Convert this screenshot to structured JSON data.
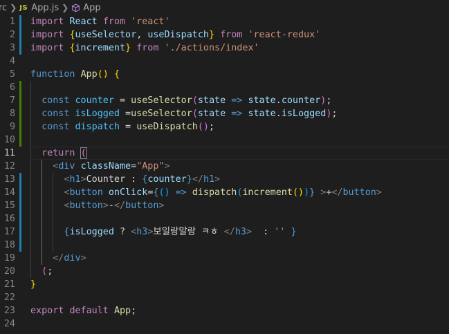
{
  "breadcrumb": {
    "folder": "rc",
    "file_badge": "JS",
    "file": "App.js",
    "symbol": "App",
    "icons": [
      "chevron-right-icon",
      "cube-icon"
    ]
  },
  "theme": {
    "background": "#1e1e1e",
    "keyword": "#c586c0",
    "storage": "#569cd6",
    "string": "#ce9178",
    "variable": "#9cdcfe",
    "function": "#dcdcaa",
    "git_modified": "#1b81a8",
    "git_added": "#487e02"
  },
  "editor": {
    "current_line": 11,
    "lines": [
      {
        "n": "1",
        "tokens": [
          [
            "k",
            "import"
          ],
          [
            "p",
            " "
          ],
          [
            "v",
            "React"
          ],
          [
            "p",
            " "
          ],
          [
            "k",
            "from"
          ],
          [
            "p",
            " "
          ],
          [
            "s",
            "'react'"
          ]
        ]
      },
      {
        "n": "2",
        "tokens": [
          [
            "k",
            "import"
          ],
          [
            "p",
            " "
          ],
          [
            "y",
            "{"
          ],
          [
            "v",
            "useSelector"
          ],
          [
            "p",
            ", "
          ],
          [
            "v",
            "useDispatch"
          ],
          [
            "y",
            "}"
          ],
          [
            "p",
            " "
          ],
          [
            "k",
            "from"
          ],
          [
            "p",
            " "
          ],
          [
            "s",
            "'react-redux'"
          ]
        ]
      },
      {
        "n": "3",
        "tokens": [
          [
            "k",
            "import"
          ],
          [
            "p",
            " "
          ],
          [
            "y",
            "{"
          ],
          [
            "v",
            "increment"
          ],
          [
            "y",
            "}"
          ],
          [
            "p",
            " "
          ],
          [
            "k",
            "from"
          ],
          [
            "p",
            " "
          ],
          [
            "s",
            "'./actions/index'"
          ]
        ]
      },
      {
        "n": "4",
        "tokens": []
      },
      {
        "n": "5",
        "tokens": [
          [
            "b",
            "function"
          ],
          [
            "p",
            " "
          ],
          [
            "f",
            "App"
          ],
          [
            "y",
            "()"
          ],
          [
            "p",
            " "
          ],
          [
            "y",
            "{"
          ]
        ]
      },
      {
        "n": "6",
        "tokens": []
      },
      {
        "n": "7",
        "tokens": [
          [
            "p",
            "  "
          ],
          [
            "b",
            "const"
          ],
          [
            "p",
            " "
          ],
          [
            "c",
            "counter"
          ],
          [
            "p",
            " = "
          ],
          [
            "f",
            "useSelector"
          ],
          [
            "m",
            "("
          ],
          [
            "v",
            "state"
          ],
          [
            "p",
            " "
          ],
          [
            "b",
            "=>"
          ],
          [
            "p",
            " "
          ],
          [
            "v",
            "state"
          ],
          [
            "p",
            "."
          ],
          [
            "v",
            "counter"
          ],
          [
            "m",
            ")"
          ],
          [
            "p",
            ";"
          ]
        ]
      },
      {
        "n": "8",
        "tokens": [
          [
            "p",
            "  "
          ],
          [
            "b",
            "const"
          ],
          [
            "p",
            " "
          ],
          [
            "c",
            "isLogged"
          ],
          [
            "p",
            " ="
          ],
          [
            "f",
            "useSelector"
          ],
          [
            "m",
            "("
          ],
          [
            "v",
            "state"
          ],
          [
            "p",
            " "
          ],
          [
            "b",
            "=>"
          ],
          [
            "p",
            " "
          ],
          [
            "v",
            "state"
          ],
          [
            "p",
            "."
          ],
          [
            "v",
            "isLogged"
          ],
          [
            "m",
            ")"
          ],
          [
            "p",
            ";"
          ]
        ]
      },
      {
        "n": "9",
        "tokens": [
          [
            "p",
            "  "
          ],
          [
            "b",
            "const"
          ],
          [
            "p",
            " "
          ],
          [
            "c",
            "dispatch"
          ],
          [
            "p",
            " = "
          ],
          [
            "f",
            "useDispatch"
          ],
          [
            "m",
            "()"
          ],
          [
            "p",
            ";"
          ]
        ]
      },
      {
        "n": "10",
        "tokens": []
      },
      {
        "n": "11",
        "tokens": [
          [
            "p",
            "  "
          ],
          [
            "k",
            "return"
          ],
          [
            "p",
            " "
          ],
          [
            "m bm",
            "("
          ]
        ]
      },
      {
        "n": "12",
        "tokens": [
          [
            "p",
            "    "
          ],
          [
            "t",
            "<"
          ],
          [
            "b",
            "div"
          ],
          [
            "p",
            " "
          ],
          [
            "v",
            "className"
          ],
          [
            "p",
            "="
          ],
          [
            "s",
            "\"App\""
          ],
          [
            "t",
            ">"
          ]
        ]
      },
      {
        "n": "13",
        "tokens": [
          [
            "p",
            "      "
          ],
          [
            "t",
            "<"
          ],
          [
            "b",
            "h1"
          ],
          [
            "t",
            ">"
          ],
          [
            "p",
            "Counter : "
          ],
          [
            "b",
            "{"
          ],
          [
            "v",
            "counter"
          ],
          [
            "b",
            "}"
          ],
          [
            "t",
            "</"
          ],
          [
            "b",
            "h1"
          ],
          [
            "t",
            ">"
          ]
        ]
      },
      {
        "n": "14",
        "tokens": [
          [
            "p",
            "      "
          ],
          [
            "t",
            "<"
          ],
          [
            "b",
            "button"
          ],
          [
            "p",
            " "
          ],
          [
            "v",
            "onClick"
          ],
          [
            "p",
            "="
          ],
          [
            "b",
            "{"
          ],
          [
            "bl",
            "()"
          ],
          [
            "p",
            " "
          ],
          [
            "b",
            "=>"
          ],
          [
            "p",
            " "
          ],
          [
            "f",
            "dispatch"
          ],
          [
            "bl",
            "("
          ],
          [
            "f",
            "increment"
          ],
          [
            "y",
            "()"
          ],
          [
            "bl",
            ")"
          ],
          [
            "b",
            "}"
          ],
          [
            "p",
            " "
          ],
          [
            "t",
            ">"
          ],
          [
            "p",
            "+"
          ],
          [
            "t",
            "</"
          ],
          [
            "b",
            "button"
          ],
          [
            "t",
            ">"
          ]
        ]
      },
      {
        "n": "15",
        "tokens": [
          [
            "p",
            "      "
          ],
          [
            "t",
            "<"
          ],
          [
            "b",
            "button"
          ],
          [
            "t",
            ">"
          ],
          [
            "p",
            "-"
          ],
          [
            "t",
            "</"
          ],
          [
            "b",
            "button"
          ],
          [
            "t",
            ">"
          ]
        ]
      },
      {
        "n": "16",
        "tokens": []
      },
      {
        "n": "17",
        "tokens": [
          [
            "p",
            "      "
          ],
          [
            "b",
            "{"
          ],
          [
            "v",
            "isLogged"
          ],
          [
            "p",
            " ? "
          ],
          [
            "t",
            "<"
          ],
          [
            "b",
            "h3"
          ],
          [
            "t",
            ">"
          ],
          [
            "p",
            "보일랑말랑 ㅋㅎ "
          ],
          [
            "t",
            "</"
          ],
          [
            "b",
            "h3"
          ],
          [
            "t",
            ">"
          ],
          [
            "p",
            "  : "
          ],
          [
            "s",
            "''"
          ],
          [
            "p",
            " "
          ],
          [
            "b",
            "}"
          ]
        ]
      },
      {
        "n": "18",
        "tokens": []
      },
      {
        "n": "19",
        "tokens": [
          [
            "p",
            "    "
          ],
          [
            "t",
            "</"
          ],
          [
            "b",
            "div"
          ],
          [
            "t",
            ">"
          ]
        ]
      },
      {
        "n": "20",
        "tokens": [
          [
            "p",
            "  "
          ],
          [
            "m",
            "("
          ],
          [
            "p",
            ";"
          ]
        ]
      },
      {
        "n": "21",
        "tokens": [
          [
            "y",
            "}"
          ]
        ]
      },
      {
        "n": "22",
        "tokens": []
      },
      {
        "n": "23",
        "tokens": [
          [
            "k",
            "export"
          ],
          [
            "p",
            " "
          ],
          [
            "k",
            "default"
          ],
          [
            "p",
            " "
          ],
          [
            "f",
            "App"
          ],
          [
            "p",
            ";"
          ]
        ]
      },
      {
        "n": "24",
        "tokens": []
      }
    ]
  }
}
